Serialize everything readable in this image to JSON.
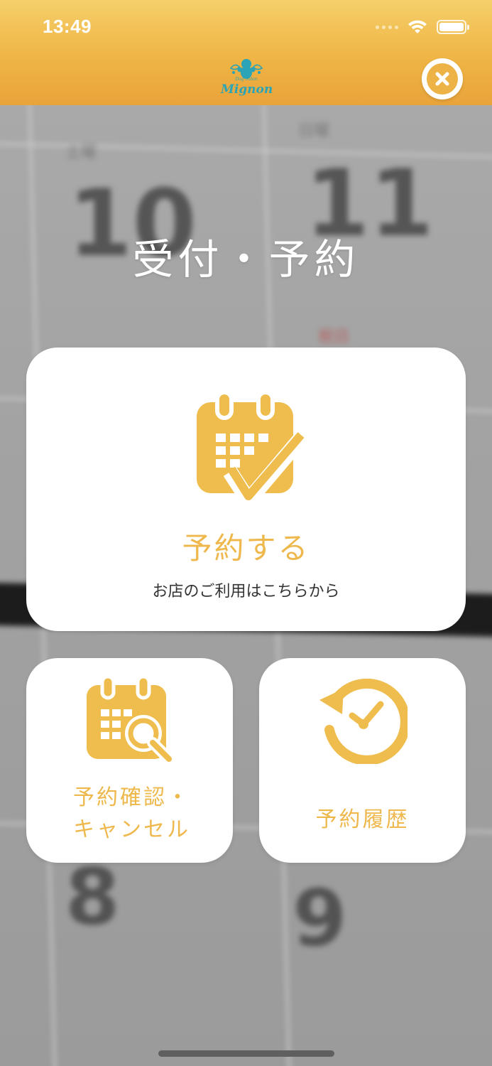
{
  "status_bar": {
    "time": "13:49"
  },
  "header": {
    "logo_text": "Mignon",
    "logo_small": "Dog Salon"
  },
  "page_title": "受付・予約",
  "main_card": {
    "label": "予約する",
    "subtitle": "お店のご利用はこちらから"
  },
  "confirm_card": {
    "line1": "予約確認・",
    "line2": "キャンセル"
  },
  "history_card": {
    "label": "予約履歴"
  },
  "background": {
    "numbers": [
      "10",
      "11",
      "8",
      "9"
    ]
  },
  "colors": {
    "accent": "#eeb84c",
    "header_top": "#f5cf6a",
    "header_bottom": "#e9a33a",
    "logo": "#2aa4b6"
  },
  "icons": {
    "close": "close-icon",
    "calendar_check": "calendar-check-icon",
    "calendar_search": "calendar-search-icon",
    "history": "history-clock-icon"
  }
}
